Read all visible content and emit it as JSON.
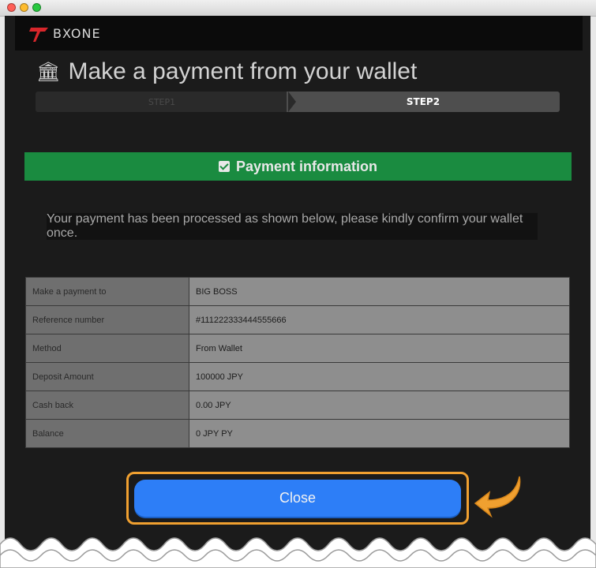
{
  "brand": {
    "name": "BXONE"
  },
  "page": {
    "title": "Make a payment from your wallet",
    "title_icon": "bank-icon"
  },
  "steps": [
    {
      "label": "STEP1",
      "active": false
    },
    {
      "label": "STEP2",
      "active": true
    }
  ],
  "banner": {
    "label": "Payment information",
    "icon": "checkbox-icon"
  },
  "notice": "Your payment has been processed as shown below, please kindly confirm your wallet once.",
  "rows": [
    {
      "label": "Make a payment to",
      "value": "BIG BOSS"
    },
    {
      "label": "Reference number",
      "value": "#111222333444555666"
    },
    {
      "label": "Method",
      "value": "From Wallet"
    },
    {
      "label": "Deposit Amount",
      "value": "100000 JPY"
    },
    {
      "label": "Cash back",
      "value": "0.00 JPY"
    },
    {
      "label": "Balance",
      "value": "0 JPY  PY"
    }
  ],
  "close_button": {
    "label": "Close"
  },
  "colors": {
    "accent": "#2d7ef7",
    "success": "#1a8b40",
    "highlight": "#f0a030"
  }
}
